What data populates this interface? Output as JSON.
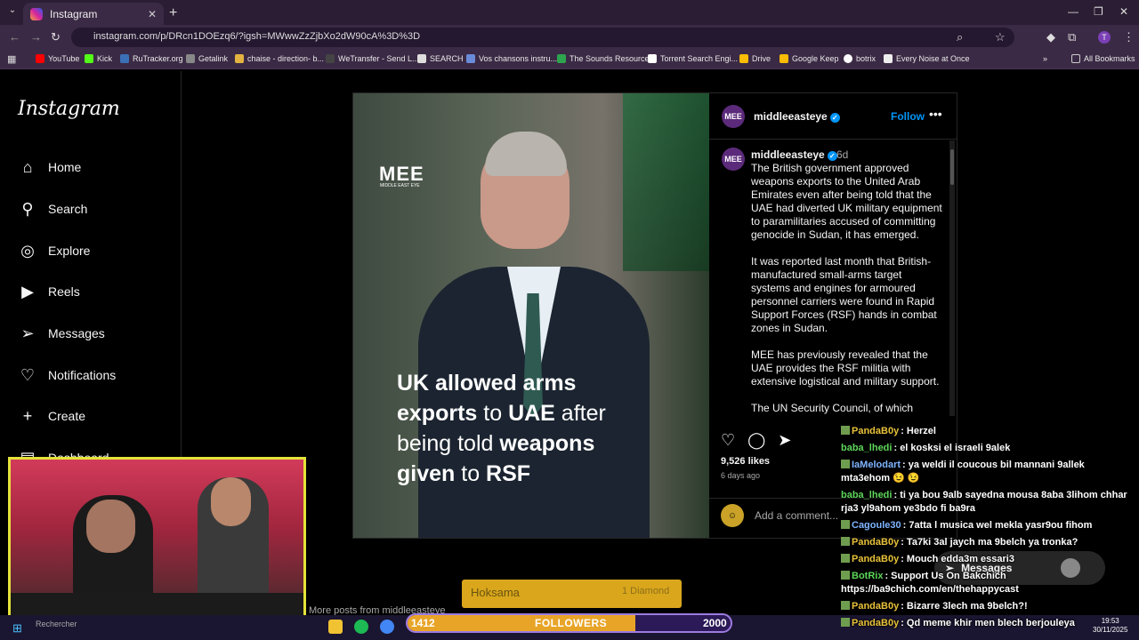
{
  "browser": {
    "tab_title": "Instagram",
    "url": "instagram.com/p/DRcn1DOEzq6/?igsh=MWwwZzZjbXo2dW90cA%3D%3D",
    "bookmarks": [
      "YouTube",
      "Kick",
      "RuTracker.org",
      "Getalink",
      "chaise - direction- b...",
      "WeTransfer - Send L...",
      "SEARCH",
      "Vos chansons instru...",
      "The Sounds Resource",
      "Torrent Search Engi...",
      "Drive",
      "Google Keep",
      "botrix",
      "Every Noise at Once"
    ],
    "all_bookmarks": "All Bookmarks",
    "profile_initial": "T"
  },
  "instagram": {
    "logo": "Instagram",
    "nav": [
      {
        "label": "Home",
        "icon": "home-icon"
      },
      {
        "label": "Search",
        "icon": "search-icon"
      },
      {
        "label": "Explore",
        "icon": "compass-icon"
      },
      {
        "label": "Reels",
        "icon": "reels-icon"
      },
      {
        "label": "Messages",
        "icon": "send-icon"
      },
      {
        "label": "Notifications",
        "icon": "heart-icon"
      },
      {
        "label": "Create",
        "icon": "plus-icon"
      },
      {
        "label": "Dashboard",
        "icon": "chart-icon"
      }
    ],
    "post": {
      "account": "middleeasteye",
      "follow": "Follow",
      "age": "6d",
      "image_brand": "MEE",
      "image_brand_sub": "MIDDLE EAST EYE",
      "headline_parts": [
        "UK allowed arms",
        "exports",
        " to ",
        "UAE",
        " after",
        "being told ",
        "weapons",
        "given",
        " to ",
        "RSF"
      ],
      "caption_p1": "The British government approved weapons exports to the United Arab Emirates even after being told that the UAE had diverted UK military equipment to paramilitaries accused of committing genocide in Sudan, it has emerged.",
      "caption_p2": "It was reported last month that British-manufactured small-arms target systems and engines for armoured personnel carriers were found in Rapid Support Forces (RSF) hands in combat zones in Sudan.",
      "caption_p3": "MEE has previously revealed that the UAE provides the RSF militia with extensive logistical and military support.",
      "caption_p4": "The UN Security Council, of which",
      "likes": "9,526 likes",
      "posted": "6 days ago",
      "add_comment": "Add a comment...",
      "more_posts": "More posts from middleeasteye"
    },
    "messages_label": "Messages"
  },
  "stream": {
    "hoksama": "Hoksama",
    "hoksama_sub": "1 Diamond",
    "followers_label": "FOLLOWERS",
    "followers_current": "1412",
    "followers_goal": "2000",
    "followers_fraction": 0.706,
    "chat": [
      {
        "user": "PandaB0y",
        "color": "#e8c13a",
        "text": ": Herzel"
      },
      {
        "user": "baba_lhedi",
        "color": "#5ed65a",
        "text": ": el kosksi el israeli 9alek"
      },
      {
        "user": "IaMelodart",
        "color": "#7fb4ff",
        "text": ": ya weldi il coucous bil mannani 9allek mta3ehom 😉 😉"
      },
      {
        "user": "baba_lhedi",
        "color": "#5ed65a",
        "text": ": ti ya bou 9alb sayedna mousa 8aba 3lihom chhar rja3 yl9ahom ye3bdo fi ba9ra"
      },
      {
        "user": "Cagoule30",
        "color": "#7fb4ff",
        "text": ": 7atta l musica wel mekla yasr9ou fihom"
      },
      {
        "user": "PandaB0y",
        "color": "#e8c13a",
        "text": ": Ta7ki 3al jaych ma 9belch ya tronka?"
      },
      {
        "user": "PandaB0y",
        "color": "#e8c13a",
        "text": ": Mouch edda3m essari3"
      },
      {
        "user": "BotRix",
        "color": "#5ed65a",
        "text": ": Support Us On Bakchich https://ba9chich.com/en/thehappycast"
      },
      {
        "user": "PandaB0y",
        "color": "#e8c13a",
        "text": ": Bizarre 3lech ma 9belch?!"
      },
      {
        "user": "PandaB0y",
        "color": "#e8c13a",
        "text": ": Qd meme khir men blech berjouleya"
      }
    ]
  },
  "taskbar": {
    "search": "Rechercher",
    "time": "19:53",
    "date": "30/11/2025"
  }
}
